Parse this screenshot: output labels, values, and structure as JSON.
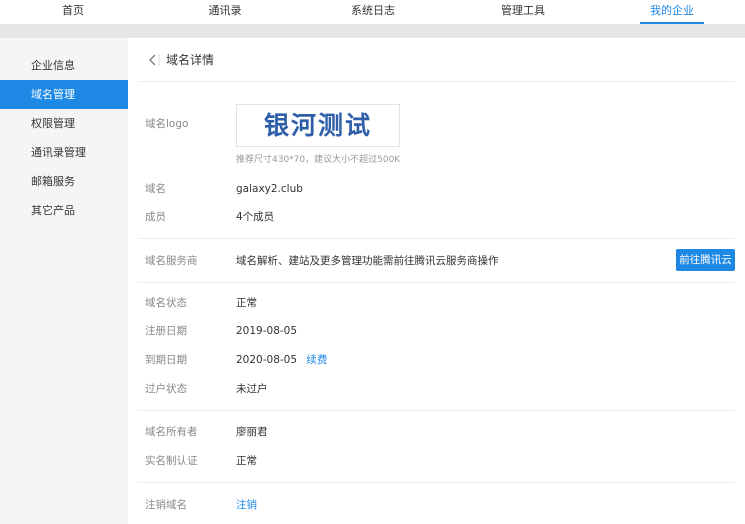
{
  "topnav": {
    "tabs": [
      {
        "label": "首页"
      },
      {
        "label": "通讯录"
      },
      {
        "label": "系统日志"
      },
      {
        "label": "管理工具"
      },
      {
        "label": "我的企业"
      }
    ],
    "active_index": 4
  },
  "sidebar": {
    "items": [
      {
        "label": "企业信息"
      },
      {
        "label": "域名管理"
      },
      {
        "label": "权限管理"
      },
      {
        "label": "通讯录管理"
      },
      {
        "label": "邮箱服务"
      },
      {
        "label": "其它产品"
      }
    ],
    "active_index": 1
  },
  "main": {
    "title": "域名详情",
    "logo": {
      "label": "域名logo",
      "text": "银河测试",
      "hint": "推荐尺寸430*70，建议大小不超过500K"
    },
    "domain": {
      "label": "域名",
      "value": "galaxy2.club"
    },
    "members": {
      "label": "成员",
      "value": "4个成员"
    },
    "provider": {
      "label": "域名服务商",
      "value": "域名解析、建站及更多管理功能需前往腾讯云服务商操作",
      "button": "前往腾讯云"
    },
    "status": {
      "label": "域名状态",
      "value": "正常"
    },
    "reg_date": {
      "label": "注册日期",
      "value": "2019-08-05"
    },
    "exp_date": {
      "label": "到期日期",
      "value": "2020-08-05",
      "link": "续费"
    },
    "transfer": {
      "label": "过户状态",
      "value": "未过户"
    },
    "owner": {
      "label": "域名所有者",
      "value": "廖丽君"
    },
    "realname": {
      "label": "实名制认证",
      "value": "正常"
    },
    "cancel": {
      "label": "注销域名",
      "link": "注销"
    }
  },
  "colors": {
    "accent": "#1e88e5",
    "logo_text": "#2f5ea8",
    "sidebar_bg": "#f5f5f5"
  }
}
